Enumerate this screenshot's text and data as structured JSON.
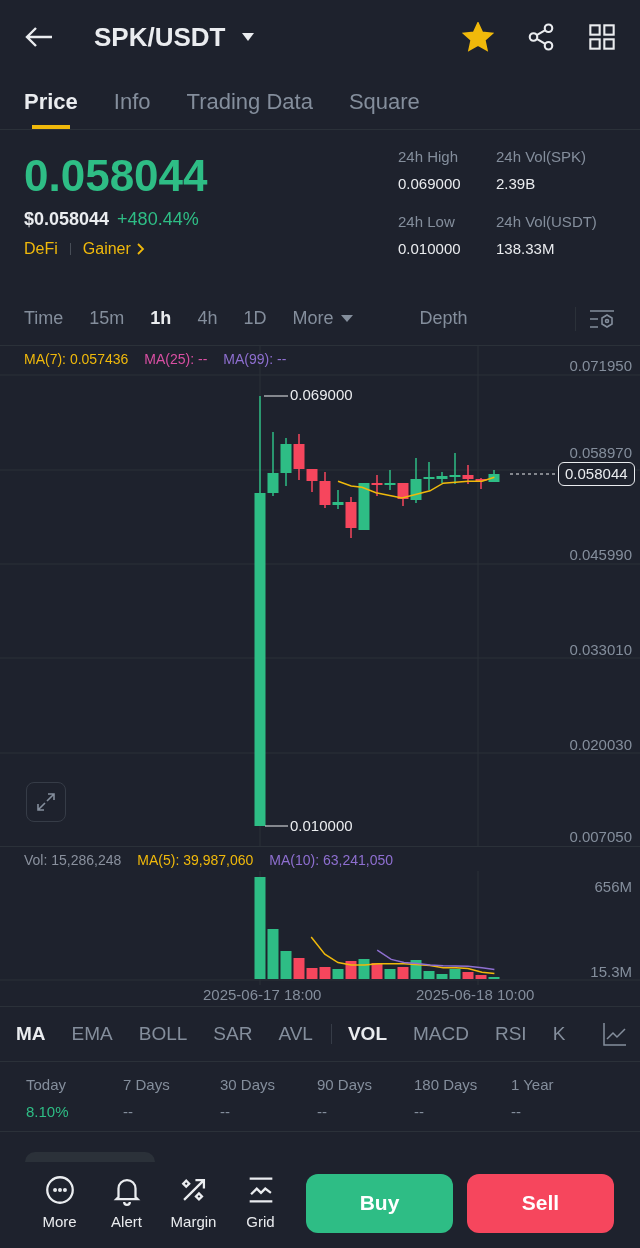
{
  "header": {
    "title": "SPK/USDT",
    "favorite": true
  },
  "tabs": [
    {
      "label": "Price",
      "selected": true
    },
    {
      "label": "Info",
      "selected": false
    },
    {
      "label": "Trading Data",
      "selected": false
    },
    {
      "label": "Square",
      "selected": false
    }
  ],
  "price": {
    "last": "0.058044",
    "usd": "$0.058044",
    "change": "+480.44%",
    "tags": [
      "DeFi",
      "Gainer"
    ]
  },
  "stats": [
    {
      "label": "24h High",
      "value": "0.069000"
    },
    {
      "label": "24h Vol(SPK)",
      "value": "2.39B"
    },
    {
      "label": "24h Low",
      "value": "0.010000"
    },
    {
      "label": "24h Vol(USDT)",
      "value": "138.33M"
    }
  ],
  "intervals": [
    {
      "label": "Time",
      "kind": "interval",
      "selected": false
    },
    {
      "label": "15m",
      "kind": "interval",
      "selected": false
    },
    {
      "label": "1h",
      "kind": "interval",
      "selected": true
    },
    {
      "label": "4h",
      "kind": "interval",
      "selected": false
    },
    {
      "label": "1D",
      "kind": "interval",
      "selected": false
    },
    {
      "label": "More",
      "kind": "menu",
      "selected": false
    },
    {
      "label": "Depth",
      "kind": "view",
      "selected": false
    }
  ],
  "ma_legend": [
    {
      "text": "MA(7): 0.057436",
      "color": "#f0b90b"
    },
    {
      "text": "MA(25): --",
      "color": "#d94fa3"
    },
    {
      "text": "MA(99): --",
      "color": "#8e6fd0"
    }
  ],
  "price_axis": [
    "0.071950",
    "0.058970",
    "0.045990",
    "0.033010",
    "0.020030",
    "0.007050"
  ],
  "high_marker": "0.069000",
  "low_marker": "0.010000",
  "current_price": "0.058044",
  "volume": {
    "legend": [
      {
        "text": "Vol: 15,286,248",
        "color": "#8a919e"
      },
      {
        "text": "MA(5): 39,987,060",
        "color": "#f0b90b"
      },
      {
        "text": "MA(10): 63,241,050",
        "color": "#8e6fd0"
      }
    ],
    "axis": [
      "656M",
      "15.3M"
    ],
    "dates": [
      "2025-06-17 18:00",
      "2025-06-18 10:00"
    ]
  },
  "main_indicators": [
    {
      "label": "MA",
      "selected": true
    },
    {
      "label": "EMA",
      "selected": false
    },
    {
      "label": "BOLL",
      "selected": false
    },
    {
      "label": "SAR",
      "selected": false
    },
    {
      "label": "AVL",
      "selected": false
    }
  ],
  "sub_indicators": [
    {
      "label": "VOL",
      "selected": true
    },
    {
      "label": "MACD",
      "selected": false
    },
    {
      "label": "RSI",
      "selected": false
    },
    {
      "label": "K",
      "selected": false
    }
  ],
  "returns": [
    {
      "period": "Today",
      "value": "8.10%",
      "color": "#2ebd85"
    },
    {
      "period": "7 Days",
      "value": "--",
      "color": "#848e9c"
    },
    {
      "period": "30 Days",
      "value": "--",
      "color": "#848e9c"
    },
    {
      "period": "90 Days",
      "value": "--",
      "color": "#848e9c"
    },
    {
      "period": "180 Days",
      "value": "--",
      "color": "#848e9c"
    },
    {
      "period": "1 Year",
      "value": "--",
      "color": "#848e9c"
    }
  ],
  "actions": [
    {
      "label": "More",
      "kind": "more"
    },
    {
      "label": "Alert",
      "kind": "alert"
    },
    {
      "label": "Margin",
      "kind": "margin"
    },
    {
      "label": "Grid",
      "kind": "grid"
    }
  ],
  "trade_buttons": [
    {
      "label": "Buy",
      "kind": "buy"
    },
    {
      "label": "Sell",
      "kind": "sell"
    }
  ]
}
